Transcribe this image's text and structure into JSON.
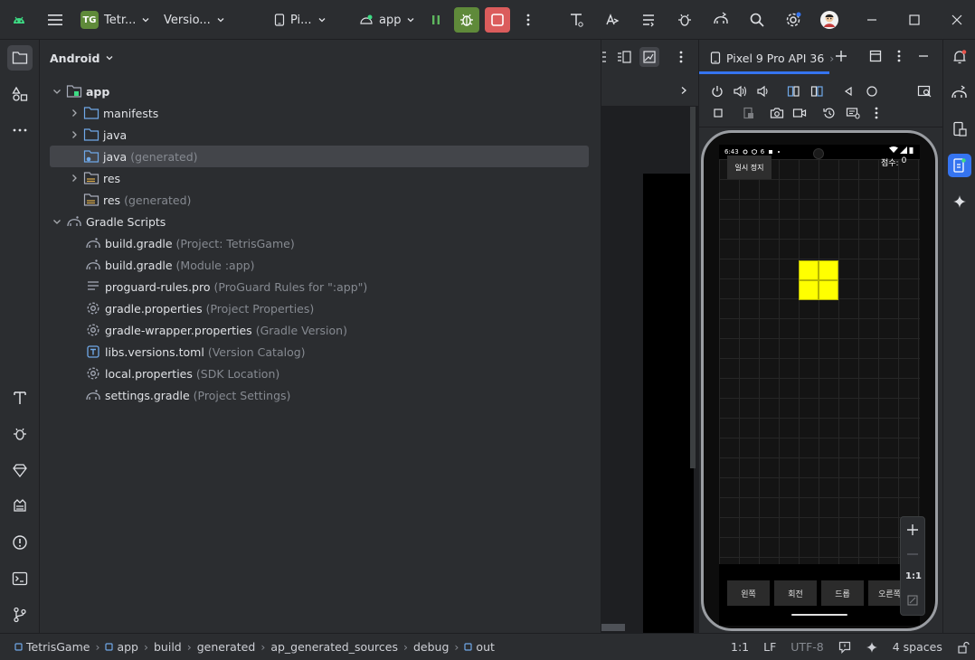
{
  "titlebar": {
    "project_badge": "TG",
    "project_name": "Tetr...",
    "vcs_branch": "Versio...",
    "device_selector": "Pi...",
    "run_config": "app"
  },
  "project_panel": {
    "view_label": "Android",
    "tree": [
      {
        "label": "app",
        "hint": "",
        "icon": "module-icon"
      },
      {
        "label": "manifests",
        "hint": "",
        "icon": "folder-icon"
      },
      {
        "label": "java",
        "hint": "",
        "icon": "folder-icon"
      },
      {
        "label": "java",
        "hint": "(generated)",
        "icon": "generated-folder-icon"
      },
      {
        "label": "res",
        "hint": "",
        "icon": "res-folder-icon"
      },
      {
        "label": "res",
        "hint": "(generated)",
        "icon": "res-folder-icon"
      },
      {
        "label": "Gradle Scripts",
        "hint": "",
        "icon": "gradle-icon"
      },
      {
        "label": "build.gradle",
        "hint": "(Project: TetrisGame)",
        "icon": "gradle-icon"
      },
      {
        "label": "build.gradle",
        "hint": "(Module :app)",
        "icon": "gradle-icon"
      },
      {
        "label": "proguard-rules.pro",
        "hint": "(ProGuard Rules for \":app\")",
        "icon": "text-file-icon"
      },
      {
        "label": "gradle.properties",
        "hint": "(Project Properties)",
        "icon": "settings-file-icon"
      },
      {
        "label": "gradle-wrapper.properties",
        "hint": "(Gradle Version)",
        "icon": "settings-file-icon"
      },
      {
        "label": "libs.versions.toml",
        "hint": "(Version Catalog)",
        "icon": "toml-file-icon"
      },
      {
        "label": "local.properties",
        "hint": "(SDK Location)",
        "icon": "settings-file-icon"
      },
      {
        "label": "settings.gradle",
        "hint": "(Project Settings)",
        "icon": "gradle-icon"
      }
    ]
  },
  "devices_panel": {
    "tab_label": "Pixel 9 Pro API 36",
    "tab_overflow": "›",
    "zoom_ratio": "1:1"
  },
  "emulator": {
    "status_time": "6:43",
    "status_extra": "6",
    "pause_button": "일시 정지",
    "score_label": "점수:",
    "score_value": "0",
    "controls": [
      "왼쪽",
      "회전",
      "드롭",
      "오른쪽"
    ],
    "block_color": "#ffff00"
  },
  "statusbar": {
    "breadcrumbs": [
      "TetrisGame",
      "app",
      "build",
      "generated",
      "ap_generated_sources",
      "debug",
      "out"
    ],
    "position": "1:1",
    "line_ending": "LF",
    "encoding": "UTF-8",
    "indent": "4 spaces"
  },
  "colors": {
    "accent": "#3574f0",
    "run_green": "#5f8a3a",
    "stop_red": "#db5c5c",
    "android_green": "#3ddc84"
  }
}
